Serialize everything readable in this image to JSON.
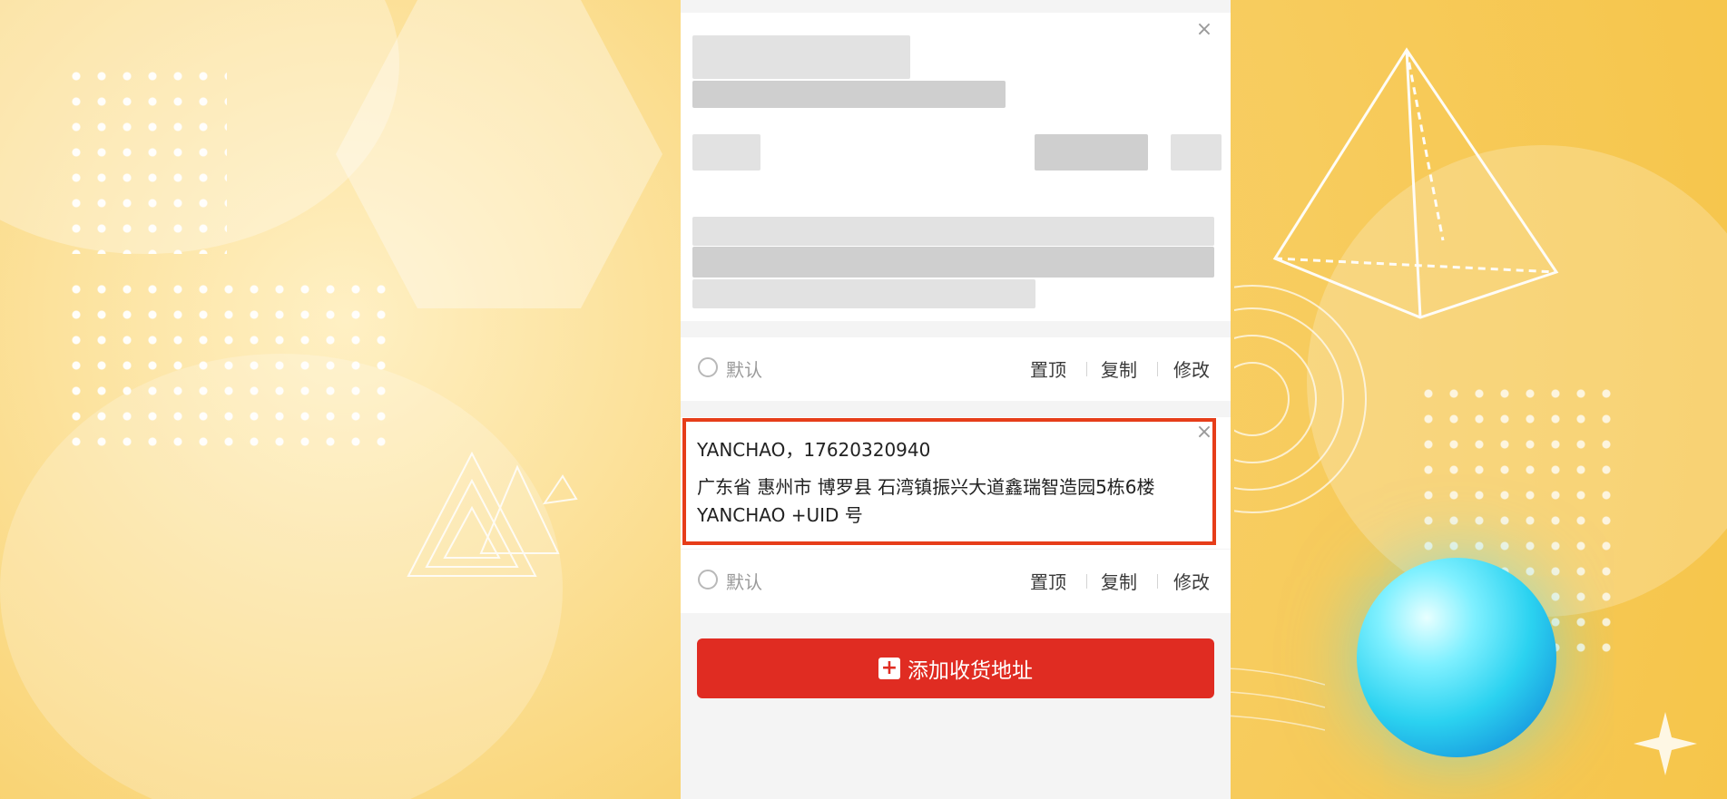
{
  "address_list": {
    "cards": [
      {
        "name_phone": "",
        "address": "",
        "default_label": "默认",
        "actions": {
          "pin": "置顶",
          "copy": "复制",
          "edit": "修改"
        }
      },
      {
        "name_phone": "YANCHAO，17620320940",
        "address": "广东省 惠州市 博罗县 石湾镇振兴大道鑫瑞智造园5栋6楼 YANCHAO +UID 号",
        "default_label": "默认",
        "actions": {
          "pin": "置顶",
          "copy": "复制",
          "edit": "修改"
        }
      }
    ]
  },
  "add_button": {
    "label": "添加收货地址",
    "icon": "plus-icon"
  },
  "colors": {
    "primary": "#e02c22",
    "highlight_border": "#e63d19",
    "background": "#f6c54a"
  }
}
